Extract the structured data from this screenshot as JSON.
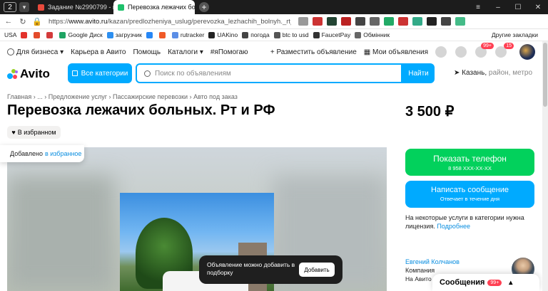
{
  "browser": {
    "tab_counter": "2",
    "tabs": [
      {
        "title": "Задание №2990799 - про",
        "favicon_color": "#e84a3c"
      },
      {
        "title": "Перевозка лежачих бол",
        "favicon_color": "#1ec06b"
      }
    ],
    "url_prefix": "https://",
    "url_domain": "www.avito.ru",
    "url_path": "/kazan/predlozheniya_uslug/perevozka_lezhachih_bolnyh._rt_i_rf_807..."
  },
  "bookmarks": [
    {
      "label": "USA",
      "color": "#ffffff"
    },
    {
      "label": "",
      "color": "#e3322b"
    },
    {
      "label": "",
      "color": "#e34b2b"
    },
    {
      "label": "",
      "color": "#d33b3b"
    },
    {
      "label": "Google Диск",
      "color": "#1fa463"
    },
    {
      "label": "загрузчик",
      "color": "#2d8ff0"
    },
    {
      "label": "",
      "color": "#2787f5"
    },
    {
      "label": "",
      "color": "#f05a28"
    },
    {
      "label": "rutracker",
      "color": "#5b8ee6"
    },
    {
      "label": "UAKino",
      "color": "#222222"
    },
    {
      "label": "погода",
      "color": "#444444"
    },
    {
      "label": "btc to usd",
      "color": "#555555"
    },
    {
      "label": "FaucetPay",
      "color": "#333333"
    },
    {
      "label": "Обмінник",
      "color": "#666666"
    }
  ],
  "bookmarks_other": "Другие закладки",
  "topnav": {
    "business": "Для бизнеса",
    "career": "Карьера в Авито",
    "help": "Помощь",
    "catalogs": "Каталоги",
    "hashtag": "#яПомогаю",
    "post_ad": "Разместить объявление",
    "my_ads": "Мои объявления",
    "messages_badge": "99+",
    "cart_badge": "15"
  },
  "search": {
    "logo": "Avito",
    "categories_label": "Все категории",
    "placeholder": "Поиск по объявлениям",
    "find_label": "Найти",
    "city": "Казань,",
    "city_hint": "район, метро"
  },
  "breadcrumbs": "Главная  ›  ...  ›  Предложение услуг  ›  Пассажирские перевозки  ›  Авто под заказ",
  "listing": {
    "title": "Перевозка лежачих больных. Рт и РФ",
    "price": "3 500 ₽",
    "favorite_label": "В избранном"
  },
  "toast_added": {
    "text": "Добавлено",
    "link": "в избранное"
  },
  "toast_collection": {
    "text": "Объявление можно добавить в подборку",
    "button": "Добавить"
  },
  "contact": {
    "phone_label": "Показать телефон",
    "phone_masked": "8 958 XXX-XX-XX",
    "message_label": "Написать сообщение",
    "message_hint": "Отвечает в течение дня",
    "notice": "На некоторые услуги в категории нужна лицензия.",
    "notice_link": "Подробнее"
  },
  "seller": {
    "name": "Евгений Колчанов",
    "role": "Компания",
    "since": "На Авито с"
  },
  "messenger": {
    "label": "Сообщения",
    "badge": "99+"
  }
}
